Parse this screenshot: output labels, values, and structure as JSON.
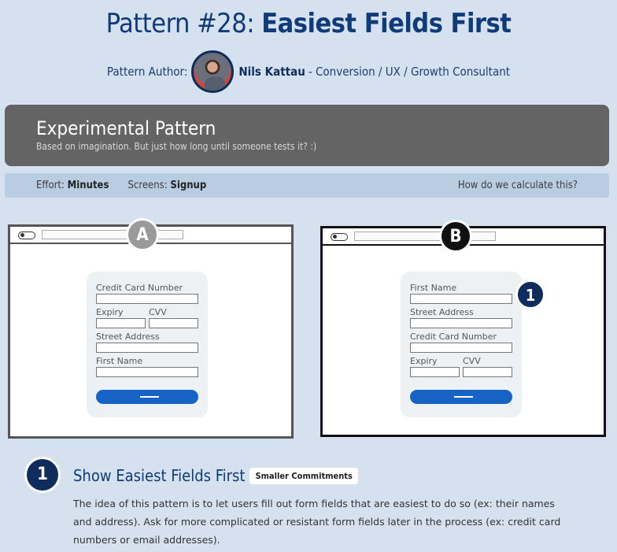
{
  "pattern": {
    "prefix": "Pattern #28:",
    "name": "Easiest Fields First"
  },
  "author": {
    "label": "Pattern Author:",
    "name": "Nils Kattau",
    "role": "- Conversion / UX / Growth Consultant"
  },
  "experimental": {
    "title": "Experimental Pattern",
    "subtitle": "Based on imagination. But just how long until someone tests it? :)"
  },
  "info": {
    "effort_label": "Effort:",
    "effort": "Minutes",
    "screens_label": "Screens:",
    "screens": "Signup",
    "how_link": "How do we calculate this?"
  },
  "variantA": {
    "badge": "A",
    "fields": [
      "Credit Card Number",
      "Expiry",
      "CVV",
      "Street Address",
      "First Name"
    ]
  },
  "variantB": {
    "badge": "B",
    "fields": [
      "First Name",
      "Street Address",
      "Credit Card Number",
      "Expiry",
      "CVV"
    ],
    "callout": "1"
  },
  "point": {
    "number": "1",
    "title": "Show Easiest Fields First",
    "tag": "Smaller Commitments",
    "description": "The idea of this pattern is to let users fill out form fields that are easiest to do so (ex: their names and address). Ask for more complicated or resistant form fields later in the process (ex: credit card numbers or email addresses)."
  },
  "colors": {
    "background": "#d5e1ee",
    "navy": "#0e2d5c",
    "experimental_bg": "#646464",
    "infobar_bg": "#b8cde2",
    "button_blue": "#1763c5"
  }
}
